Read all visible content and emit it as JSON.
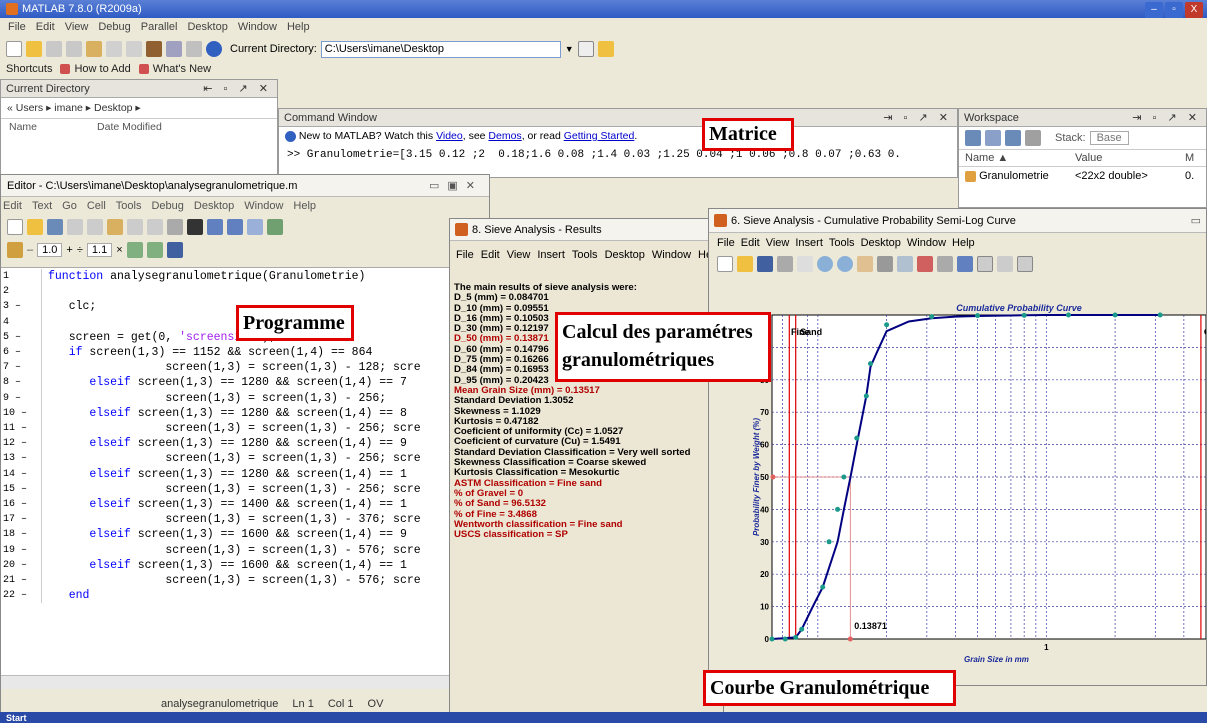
{
  "main": {
    "title": "MATLAB 7.8.0 (R2009a)",
    "menu": [
      "File",
      "Edit",
      "View",
      "Debug",
      "Parallel",
      "Desktop",
      "Window",
      "Help"
    ],
    "current_dir_label": "Current Directory:",
    "current_dir_value": "C:\\Users\\imane\\Desktop",
    "shortcuts": [
      "Shortcuts",
      "How to Add",
      "What's New"
    ]
  },
  "current_directory": {
    "title": "Current Directory",
    "path": "« Users ▸ imane ▸ Desktop ▸",
    "col_name": "Name",
    "col_date": "Date Modified"
  },
  "command_window": {
    "title": "Command Window",
    "notice_a": "New to MATLAB? Watch this ",
    "link_video": "Video",
    "notice_b": ", see ",
    "link_demos": "Demos",
    "notice_c": ", or read ",
    "link_started": "Getting Started",
    "notice_d": ".",
    "command": ">> Granulometrie=[3.15 0.12 ;2  0.18;1.6 0.08 ;1.4 0.03 ;1.25 0.04 ;1 0.06 ;0.8 0.07 ;0.63 0."
  },
  "workspace": {
    "title": "Workspace",
    "stack_label": "Stack:",
    "stack_value": "Base",
    "col_name": "Name ▲",
    "col_value": "Value",
    "col_m": "M",
    "row_name": "Granulometrie",
    "row_value": "<22x2 double>",
    "row_m": "0."
  },
  "editor": {
    "title": "Editor - C:\\Users\\imane\\Desktop\\analysegranulometrique.m",
    "menu": [
      "Edit",
      "Text",
      "Go",
      "Cell",
      "Tools",
      "Debug",
      "Desktop",
      "Window",
      "Help"
    ],
    "zoom_a": "1.0",
    "zoom_b": "1.1",
    "line_numbers": [
      "1",
      "2",
      "3 –",
      "4",
      "5 –",
      "6 –",
      "7 –",
      "8 –",
      "9 –",
      "10 –",
      "11 –",
      "12 –",
      "13 –",
      "14 –",
      "15 –",
      "16 –",
      "17 –",
      "18 –",
      "19 –",
      "20 –",
      "21 –",
      "22 –"
    ],
    "lines": [
      "function analysegranulometrique(Granulometrie)",
      "",
      "   clc;",
      "",
      "   screen = get(0, 'screensize');",
      "   if screen(1,3) == 1152 && screen(1,4) == 864",
      "                 screen(1,3) = screen(1,3) - 128; scre",
      "      elseif screen(1,3) == 1280 && screen(1,4) == 7",
      "                 screen(1,3) = screen(1,3) - 256;",
      "      elseif screen(1,3) == 1280 && screen(1,4) == 8",
      "                 screen(1,3) = screen(1,3) - 256; scre",
      "      elseif screen(1,3) == 1280 && screen(1,4) == 9",
      "                 screen(1,3) = screen(1,3) - 256; scre",
      "      elseif screen(1,3) == 1280 && screen(1,4) == 1",
      "                 screen(1,3) = screen(1,3) - 256; scre",
      "      elseif screen(1,3) == 1400 && screen(1,4) == 1",
      "                 screen(1,3) = screen(1,3) - 376; scre",
      "      elseif screen(1,3) == 1600 && screen(1,4) == 9",
      "                 screen(1,3) = screen(1,3) - 576; scre",
      "      elseif screen(1,3) == 1600 && screen(1,4) == 1",
      "                 screen(1,3) = screen(1,3) - 576; scre",
      "   end"
    ],
    "status_file": "analysegranulometrique",
    "status_ln": "Ln  1",
    "status_col": "Col  1",
    "status_ovr": "OV"
  },
  "results": {
    "title": "8. Sieve Analysis - Results",
    "menu": [
      "File",
      "Edit",
      "View",
      "Insert",
      "Tools",
      "Desktop",
      "Window",
      "He"
    ],
    "lines": [
      {
        "t": "The main results of sieve analysis were:",
        "c": "black"
      },
      {
        "t": "D_5 (mm) = 0.084701",
        "c": "black"
      },
      {
        "t": "D_10 (mm) = 0.09551",
        "c": "black"
      },
      {
        "t": "D_16 (mm) = 0.10503",
        "c": "black"
      },
      {
        "t": "D_30 (mm) = 0.12197",
        "c": "black"
      },
      {
        "t": "D_50 (mm) = 0.13871",
        "c": "red"
      },
      {
        "t": "D_60 (mm) = 0.14796",
        "c": "black"
      },
      {
        "t": "D_75 (mm) = 0.16266",
        "c": "black"
      },
      {
        "t": "D_84 (mm) = 0.16953",
        "c": "black"
      },
      {
        "t": "D_95 (mm) = 0.20423",
        "c": "black"
      },
      {
        "t": "Mean Grain Size  (mm) = 0.13517",
        "c": "red"
      },
      {
        "t": "Standard Deviation 1.3052",
        "c": "black"
      },
      {
        "t": "Skewness = 1.1029",
        "c": "black"
      },
      {
        "t": "Kurtosis = 0.47182",
        "c": "black"
      },
      {
        "t": "Coeficient of uniformity (Cc) = 1.0527",
        "c": "black"
      },
      {
        "t": "Coeficient of curvature (Cu) = 1.5491",
        "c": "black"
      },
      {
        "t": "Standard Deviation Classification = Very well sorted",
        "c": "black"
      },
      {
        "t": "Skewness Classification = Coarse skewed",
        "c": "black"
      },
      {
        "t": "Kurtosis Classification = Mesokurtic",
        "c": "black"
      },
      {
        "t": "ASTM Classification = Fine sand",
        "c": "red"
      },
      {
        "t": "% of Gravel = 0",
        "c": "red"
      },
      {
        "t": "% of Sand = 96.5132",
        "c": "red"
      },
      {
        "t": "% of Fine = 3.4868",
        "c": "red"
      },
      {
        "t": "Wentworth classification = Fine sand",
        "c": "red"
      },
      {
        "t": "USCS classification = SP",
        "c": "red"
      }
    ]
  },
  "curve_window": {
    "title": "6. Sieve Analysis - Cumulative Probability Semi-Log Curve",
    "menu": [
      "File",
      "Edit",
      "View",
      "Insert",
      "Tools",
      "Desktop",
      "Window",
      "Help"
    ],
    "plot_title": "Cumulative Probability Curve",
    "ylabel": "Probability Finer by Weight (%)",
    "xlabel": "Grain Size in mm",
    "region_fine": "Fine",
    "region_sand": "Sand",
    "region_gravel": "Gravel",
    "d50_label": "0.13871",
    "x_tick_1": "1",
    "y_ticks": [
      "100",
      "90",
      "80",
      "70",
      "60",
      "50",
      "40",
      "30",
      "20",
      "10",
      "0"
    ]
  },
  "annotations": {
    "matrice": "Matrice",
    "programme": "Programme",
    "calcul": "Calcul des paramétres granulométriques",
    "courbe": "Courbe Granulométrique"
  },
  "taskbar": {
    "start": "Start"
  },
  "chart_data": {
    "type": "line",
    "title": "Cumulative Probability Curve",
    "xlabel": "Grain Size in mm",
    "ylabel": "Probability Finer by Weight (%)",
    "xscale": "log",
    "ylim": [
      0,
      100
    ],
    "x": [
      0.063,
      0.08,
      0.085,
      0.095,
      0.105,
      0.112,
      0.122,
      0.13,
      0.139,
      0.148,
      0.163,
      0.17,
      0.18,
      0.2,
      0.25,
      0.315,
      0.4,
      0.5,
      0.63,
      0.8,
      1,
      1.25,
      1.6,
      2,
      3.15
    ],
    "y": [
      0,
      0.5,
      3,
      10,
      16,
      22,
      30,
      40,
      50,
      60,
      75,
      84,
      88,
      95,
      98,
      99,
      99.5,
      99.7,
      99.8,
      99.9,
      100,
      100,
      100,
      100,
      100
    ],
    "markers": [
      [
        0.063,
        0
      ],
      [
        0.072,
        0
      ],
      [
        0.08,
        0.5
      ],
      [
        0.085,
        3
      ],
      [
        0.105,
        16
      ],
      [
        0.112,
        30
      ],
      [
        0.122,
        40
      ],
      [
        0.13,
        50
      ],
      [
        0.148,
        62
      ],
      [
        0.163,
        75
      ],
      [
        0.17,
        85
      ],
      [
        0.2,
        97
      ],
      [
        0.315,
        99.5
      ],
      [
        0.5,
        99.8
      ],
      [
        0.8,
        99.9
      ],
      [
        1.25,
        100
      ],
      [
        2,
        100
      ],
      [
        3.15,
        100
      ]
    ],
    "vlines_red": [
      0.075,
      0.08,
      4.75
    ],
    "d50": 0.13871,
    "colors": {
      "line": "#000080",
      "marker": "#1a9a8a",
      "region_lines": "#e00000",
      "grid": "#3a3aa0"
    }
  }
}
